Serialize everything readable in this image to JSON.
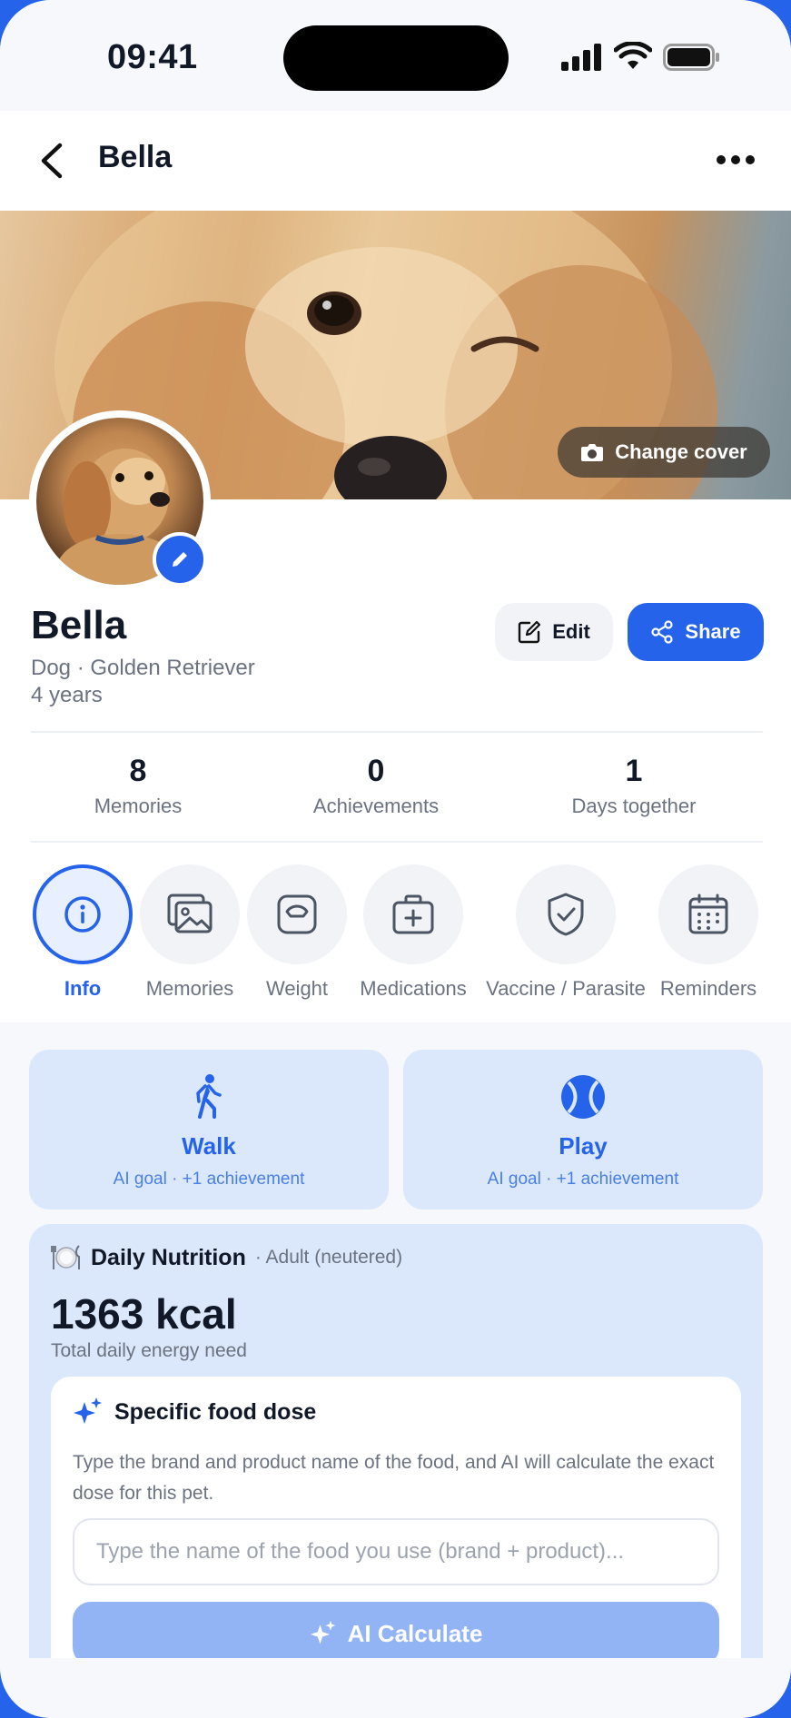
{
  "status_bar": {
    "time": "09:41"
  },
  "nav": {
    "title": "Bella"
  },
  "cover": {
    "change_label": "Change cover"
  },
  "pet": {
    "name": "Bella",
    "species_breed": "Dog · Golden Retriever",
    "age": "4 years"
  },
  "actions": {
    "edit_label": "Edit",
    "share_label": "Share"
  },
  "stats": [
    {
      "value": "8",
      "label": "Memories"
    },
    {
      "value": "0",
      "label": "Achievements"
    },
    {
      "value": "1",
      "label": "Days together"
    }
  ],
  "tabs": [
    {
      "label": "Info",
      "icon": "info-icon",
      "active": true
    },
    {
      "label": "Memories",
      "icon": "gallery-icon"
    },
    {
      "label": "Weight",
      "icon": "scale-icon"
    },
    {
      "label": "Medications",
      "icon": "medkit-icon"
    },
    {
      "label": "Vaccine / Parasite",
      "icon": "shield-check-icon"
    },
    {
      "label": "Reminders",
      "icon": "calendar-icon"
    }
  ],
  "activities": [
    {
      "title": "Walk",
      "subtitle": "AI goal · +1 achievement",
      "icon": "walk-icon"
    },
    {
      "title": "Play",
      "subtitle": "AI goal · +1 achievement",
      "icon": "ball-icon"
    }
  ],
  "nutrition": {
    "title": "Daily Nutrition",
    "tag": "· Adult (neutered)",
    "kcal": "1363 kcal",
    "kcal_label": "Total daily energy need",
    "dose": {
      "title": "Specific food dose",
      "description": "Type the brand and product name of the food, and AI will calculate the exact dose for this pet.",
      "placeholder": "Type the name of the food you use (brand + product)...",
      "button_label": "AI Calculate"
    }
  },
  "colors": {
    "accent": "#2563eb",
    "card_bg": "#dbe8fb",
    "muted_text": "#6b7280"
  }
}
